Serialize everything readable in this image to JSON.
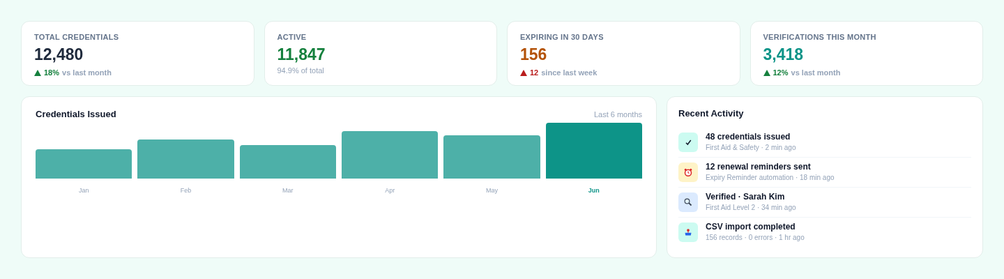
{
  "stats": [
    {
      "label": "TOTAL CREDENTIALS",
      "value": "12,480",
      "color": "#1e293b",
      "delta": {
        "rising": true,
        "positive": true,
        "amount": "18%",
        "text": "vs last month"
      }
    },
    {
      "label": "ACTIVE",
      "value": "11,847",
      "color": "#15803d",
      "note": "94.9% of total"
    },
    {
      "label": "EXPIRING IN 30 DAYS",
      "value": "156",
      "color": "#b45309",
      "delta": {
        "rising": true,
        "positive": false,
        "amount": "12",
        "text": "since last week"
      }
    },
    {
      "label": "VERIFICATIONS THIS MONTH",
      "value": "3,418",
      "color": "#0d9488",
      "delta": {
        "rising": true,
        "positive": true,
        "amount": "12%",
        "text": "vs last month"
      }
    }
  ],
  "chart": {
    "title": "Credentials Issued",
    "range": "Last 6 months",
    "months": [
      {
        "label": "Jan",
        "selected": false
      },
      {
        "label": "Feb",
        "selected": false
      },
      {
        "label": "Mar",
        "selected": false
      },
      {
        "label": "Apr",
        "selected": false
      },
      {
        "label": "May",
        "selected": false
      },
      {
        "label": "Jun",
        "selected": true
      }
    ]
  },
  "activity": {
    "title": "Recent Activity",
    "items": [
      {
        "kind": "issued",
        "title": "48 credentials issued",
        "meta": "First Aid & Safety · 2 min ago"
      },
      {
        "kind": "reminder",
        "title": "12 renewal reminders sent",
        "meta": "Expiry Reminder automation · 18 min ago"
      },
      {
        "kind": "verified",
        "title": "Verified · Sarah Kim",
        "meta": "First Aid Level 2 · 34 min ago"
      },
      {
        "kind": "import",
        "title": "CSV import completed",
        "meta": "156 records · 0 errors · 1 hr ago"
      }
    ]
  }
}
